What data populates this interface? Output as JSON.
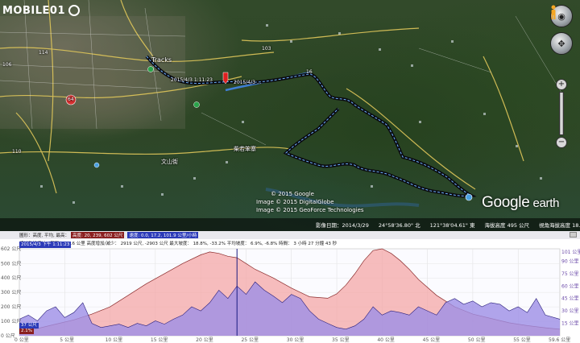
{
  "branding": {
    "site_logo_text": "MOBILE01"
  },
  "map": {
    "place_labels": [
      "Tracks",
      "2015/4/3 1:11:23",
      "2015/4/3 ...",
      "柴若笨寨",
      "文山街"
    ],
    "road_numbers": [
      "103",
      "106",
      "110",
      "114",
      "64",
      "16"
    ],
    "copyright": [
      "© 2015 Google",
      "Image © 2015 DigitalGlobe",
      "Image © 2015 GeoForce Technologies"
    ],
    "google_earth": {
      "word1": "Google",
      "word2": "earth"
    }
  },
  "statusbar": {
    "imagery_date": "影像日期：2014/3/29",
    "lat": "24°58'36.80\" 北",
    "lon": "121°38'04.61\" 東",
    "elev_label": "海拔高度",
    "elev_value": "495 公尺",
    "eye_label": "視角海拔高度",
    "eye_value": "18.02 公里"
  },
  "profile": {
    "info_line": "圖形：高度, 平均, 最高：",
    "info_highlight": "高度: 20, 239, 602 公尺",
    "info_highlight2": "速度: 0.0, 17.2, 101.9 公里/小時",
    "range_line": "總計數據統計：距離： 59.6 公里 高度增加/減少： 2919 公尺, -2903 公尺 最大坡度： 18.8%, -33.2% 平均坡度： 6.9%, -6.8% 時間： 3 小時 27 分鐘 43 秒",
    "date_label": "2015/4/3 下午 1:11:23",
    "cursor_elevation": "37 公尺",
    "cursor_speed": "上空小時",
    "cursor_grade": "2.1%"
  },
  "chart_data": {
    "type": "area",
    "title": "",
    "xlabel": "",
    "ylabel": "",
    "x_unit": "公里",
    "y_unit": "公尺",
    "xlim": [
      0,
      59.6
    ],
    "ylim": [
      0,
      602
    ],
    "y2lim": [
      0,
      105
    ],
    "x_ticks": [
      "0 公里",
      "5 公里",
      "10 公里",
      "15 公里",
      "20 公里",
      "25 公里",
      "30 公里",
      "35 公里",
      "40 公里",
      "45 公里",
      "50 公里",
      "55 公里",
      "59.6 公里"
    ],
    "y_ticks": [
      "0 公尺",
      "100 公尺",
      "200 公尺",
      "300 公尺",
      "400 公尺",
      "500 公尺",
      "602 公尺"
    ],
    "y2_ticks": [
      "15 公里",
      "30 公里",
      "45 公里",
      "60 公里",
      "75 公里",
      "90 公里",
      "101 公里"
    ],
    "series": [
      {
        "name": "高度",
        "color": "#f4a7a7",
        "x": [
          0,
          2,
          4,
          6,
          8,
          10,
          12,
          14,
          16,
          18,
          20,
          21,
          22,
          23,
          24,
          25,
          26,
          28,
          30,
          32,
          34,
          35,
          36,
          37,
          38,
          39,
          40,
          41,
          42,
          43,
          44,
          46,
          48,
          50,
          52,
          54,
          56,
          58,
          59.6
        ],
        "values": [
          20,
          50,
          80,
          110,
          150,
          200,
          280,
          360,
          430,
          500,
          560,
          580,
          570,
          550,
          540,
          500,
          460,
          400,
          330,
          270,
          260,
          290,
          350,
          430,
          520,
          590,
          602,
          570,
          520,
          460,
          390,
          280,
          200,
          150,
          120,
          90,
          70,
          55,
          45
        ]
      },
      {
        "name": "速度",
        "color": "#9d8fe6",
        "x": [
          0,
          1,
          2,
          3,
          4,
          5,
          6,
          7,
          8,
          9,
          10,
          11,
          12,
          13,
          14,
          15,
          16,
          17,
          18,
          19,
          20,
          21,
          22,
          23,
          24,
          25,
          26,
          27,
          28,
          29,
          30,
          31,
          32,
          33,
          34,
          35,
          36,
          37,
          38,
          39,
          40,
          41,
          42,
          43,
          44,
          45,
          46,
          47,
          48,
          49,
          50,
          51,
          52,
          53,
          54,
          55,
          56,
          57,
          58,
          59.6
        ],
        "values": [
          20,
          25,
          18,
          30,
          35,
          22,
          28,
          40,
          15,
          10,
          12,
          14,
          10,
          15,
          12,
          18,
          14,
          20,
          25,
          35,
          30,
          40,
          55,
          45,
          60,
          50,
          65,
          55,
          48,
          40,
          50,
          45,
          30,
          20,
          15,
          10,
          8,
          12,
          20,
          35,
          25,
          30,
          28,
          25,
          35,
          30,
          25,
          40,
          45,
          38,
          42,
          35,
          40,
          38,
          30,
          35,
          28,
          45,
          25,
          20
        ]
      }
    ],
    "grid": true
  }
}
